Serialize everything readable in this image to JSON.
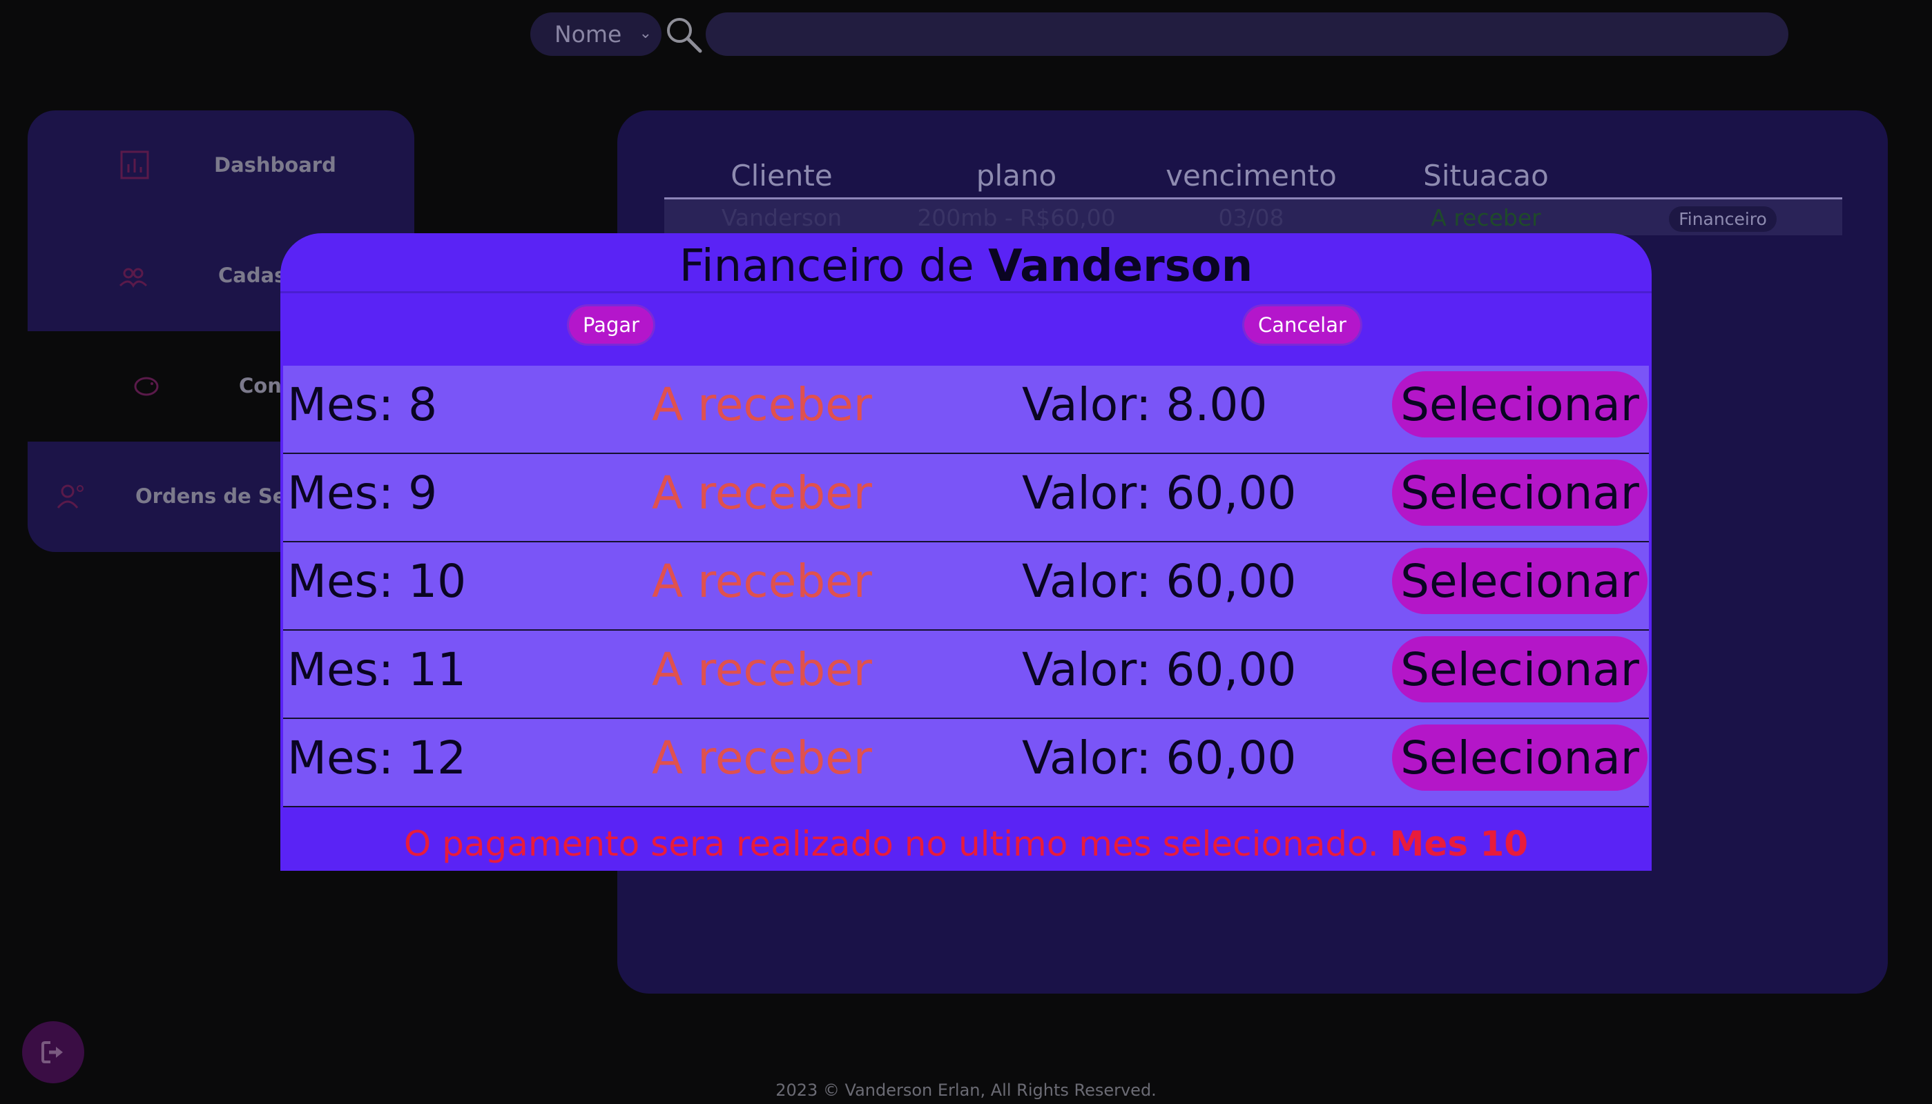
{
  "search": {
    "filter_value": "Nome",
    "query": ""
  },
  "sidebar": {
    "items": [
      {
        "label": "Dashboard",
        "icon": "chart-icon"
      },
      {
        "label": "Cadas",
        "icon": "users-icon"
      },
      {
        "label": "Con",
        "icon": "piggy-bank-icon"
      },
      {
        "label": "Ordens de Serv",
        "icon": "user-gear-icon"
      }
    ]
  },
  "table": {
    "headers": [
      "Cliente",
      "plano",
      "vencimento",
      "Situacao"
    ],
    "row": {
      "cliente": "Vanderson",
      "plano": "200mb - R$60,00",
      "vencimento": "03/08",
      "situacao": "A receber",
      "action": "Financeiro"
    }
  },
  "modal": {
    "title_prefix": "Financeiro de",
    "title_name": "Vanderson",
    "pay_label": "Pagar",
    "cancel_label": "Cancelar",
    "rows": [
      {
        "mes": "Mes: 8",
        "status": "A receber",
        "valor": "Valor: 8.00",
        "action": "Selecionar"
      },
      {
        "mes": "Mes: 9",
        "status": "A receber",
        "valor": "Valor: 60,00",
        "action": "Selecionar"
      },
      {
        "mes": "Mes: 10",
        "status": "A receber",
        "valor": "Valor: 60,00",
        "action": "Selecionar"
      },
      {
        "mes": "Mes: 11",
        "status": "A receber",
        "valor": "Valor: 60,00",
        "action": "Selecionar"
      },
      {
        "mes": "Mes: 12",
        "status": "A receber",
        "valor": "Valor: 60,00",
        "action": "Selecionar"
      }
    ],
    "notice_text": "O pagamento sera realizado no ultimo mes selecionado.",
    "notice_highlight": "Mes 10"
  },
  "footer": "2023 © Vanderson Erlan, All Rights Reserved.",
  "colors": {
    "background": "#0a0a0b",
    "modal": "#5a23f5",
    "row": "#7a55f7",
    "button": "#b416c8",
    "status_text": "#e0514e",
    "notice_text": "#e81c3c"
  }
}
